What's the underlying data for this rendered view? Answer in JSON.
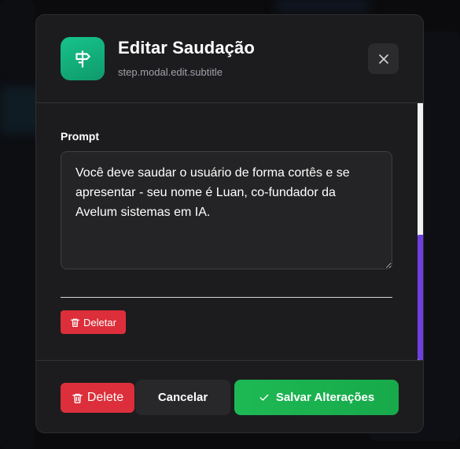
{
  "modal": {
    "title": "Editar Saudação",
    "subtitle": "step.modal.edit.subtitle",
    "header_icon": "signpost-icon",
    "close_icon": "close-icon"
  },
  "form": {
    "prompt_label": "Prompt",
    "prompt_value": "Você deve saudar o usuário de forma cortês e se apresentar - seu nome é Luan, co-fundador da Avelum sistemas em IA.",
    "inline_delete_label": "Deletar"
  },
  "footer": {
    "delete_label": "Delete",
    "cancel_label": "Cancelar",
    "save_label": "Salvar Alterações"
  },
  "colors": {
    "accent_green": "#1db954",
    "danger_red": "#dc2f3b",
    "scroll_thumb": "#6d3fe0"
  }
}
